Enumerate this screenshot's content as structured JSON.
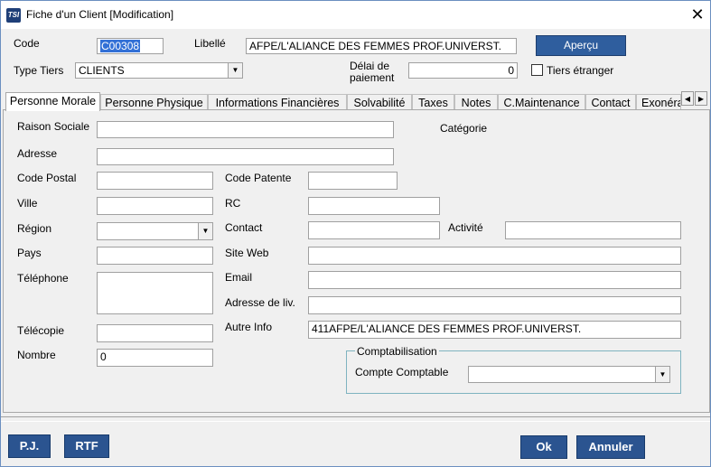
{
  "window": {
    "title": "Fiche d'un Client [Modification]",
    "app_icon": "TSI",
    "close": "✕"
  },
  "header": {
    "code_label": "Code",
    "code_value": "C00308",
    "libelle_label": "Libellé",
    "libelle_value": "AFPE/L'ALIANCE DES FEMMES PROF.UNIVERST.",
    "apercu_label": "Aperçu",
    "type_tiers_label": "Type Tiers",
    "type_tiers_value": "CLIENTS",
    "delai_label_1": "Délai de",
    "delai_label_2": "paiement",
    "delai_value": "0",
    "tiers_etranger_label": "Tiers étranger"
  },
  "tabs": [
    "Personne Morale",
    "Personne Physique",
    "Informations Financières",
    "Solvabilité",
    "Taxes",
    "Notes",
    "C.Maintenance",
    "Contact",
    "Exonéra"
  ],
  "tab_scroll": {
    "left": "◀",
    "right": "▶"
  },
  "form": {
    "raison_sociale_label": "Raison Sociale",
    "raison_sociale_value": "",
    "categorie_label": "Catégorie",
    "adresse_label": "Adresse",
    "adresse_value": "",
    "code_postal_label": "Code Postal",
    "code_postal_value": "",
    "code_patente_label": "Code Patente",
    "code_patente_value": "",
    "ville_label": "Ville",
    "ville_value": "",
    "rc_label": "RC",
    "rc_value": "",
    "region_label": "Région",
    "region_value": "",
    "contact_label": "Contact",
    "contact_value": "",
    "activite_label": "Activité",
    "activite_value": "",
    "pays_label": "Pays",
    "pays_value": "",
    "site_web_label": "Site Web",
    "site_web_value": "",
    "telephone_label": "Téléphone",
    "telephone_value": "",
    "email_label": "Email",
    "email_value": "",
    "adresse_liv_label": "Adresse de liv.",
    "adresse_liv_value": "",
    "telecopie_label": "Télécopie",
    "telecopie_value": "",
    "autre_info_label": "Autre Info",
    "autre_info_value": "411AFPE/L'ALIANCE DES FEMMES PROF.UNIVERST.",
    "nombre_label": "Nombre",
    "nombre_value": "0",
    "comptabilisation_title": "Comptabilisation",
    "compte_comptable_label": "Compte Comptable",
    "compte_comptable_value": ""
  },
  "footer": {
    "pj": "P.J.",
    "rtf": "RTF",
    "ok": "Ok",
    "annuler": "Annuler"
  },
  "colors": {
    "accent_button": "#2f5e9e",
    "selection": "#3270d6",
    "groupbox_border": "#7fb3c0"
  }
}
